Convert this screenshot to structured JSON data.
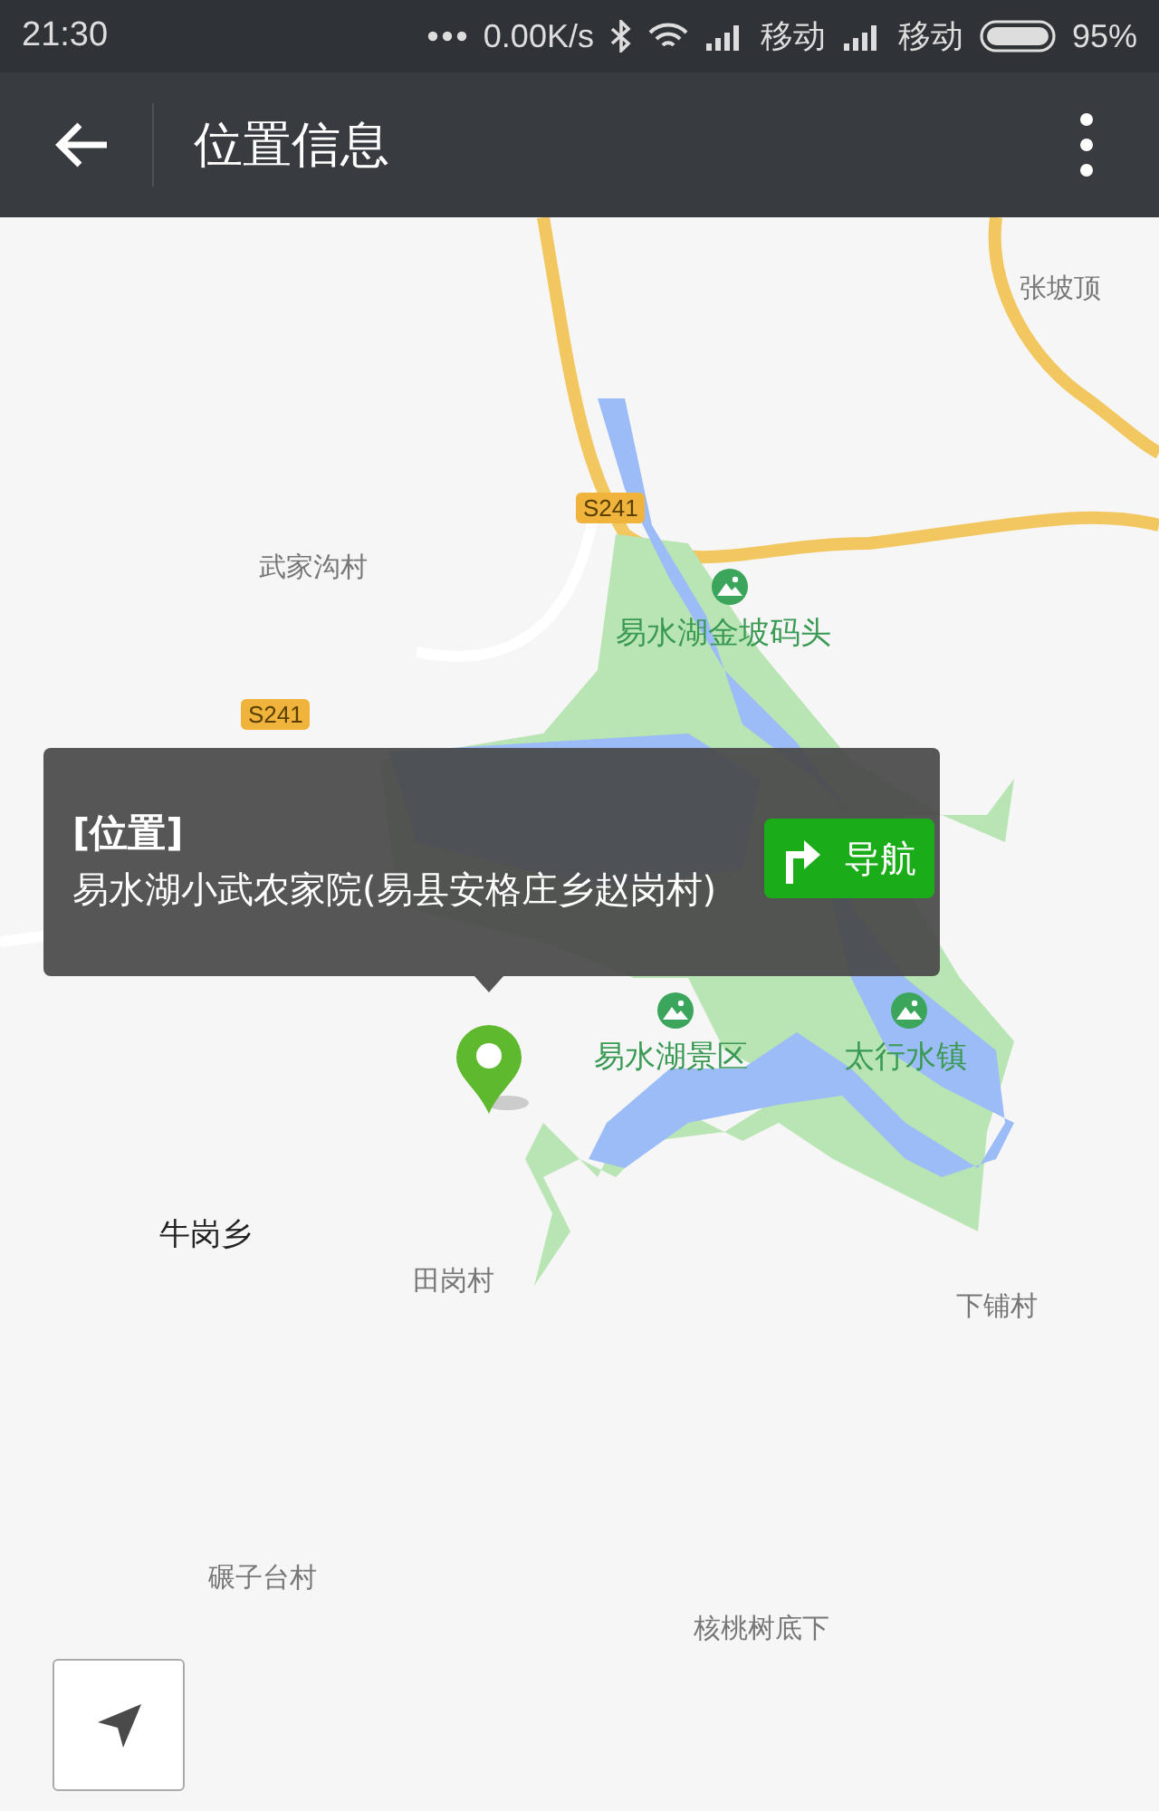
{
  "status_bar": {
    "time": "21:30",
    "speed": "0.00K/s",
    "carriers": [
      "移动",
      "移动"
    ],
    "battery": "95%"
  },
  "app_bar": {
    "title": "位置信息"
  },
  "map": {
    "labels": [
      {
        "text": "张坡顶",
        "kind": "village"
      },
      {
        "text": "S241",
        "kind": "road"
      },
      {
        "text": "武家沟村",
        "kind": "village"
      },
      {
        "text": "易水湖金坡码头",
        "kind": "poi"
      },
      {
        "text": "S241",
        "kind": "road"
      },
      {
        "text": "易水湖景区",
        "kind": "poi"
      },
      {
        "text": "太行水镇",
        "kind": "poi"
      },
      {
        "text": "牛岗乡",
        "kind": "town"
      },
      {
        "text": "田岗村",
        "kind": "village"
      },
      {
        "text": "下铺村",
        "kind": "village"
      },
      {
        "text": "碾子台村",
        "kind": "village"
      },
      {
        "text": "核桃树底下",
        "kind": "village"
      }
    ]
  },
  "popup": {
    "title": "[位置]",
    "address": "易水湖小武农家院(易县安格庄乡赵岗村)",
    "button": "导航"
  }
}
